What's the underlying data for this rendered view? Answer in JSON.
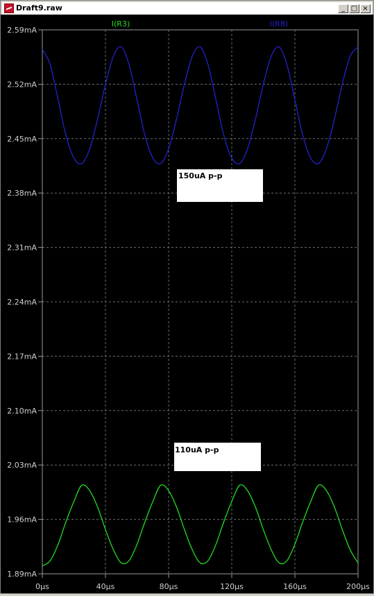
{
  "window": {
    "title": "Draft9.raw",
    "controls": {
      "minimize": "_",
      "restore": "□",
      "close": "×"
    }
  },
  "chart_data": {
    "type": "line",
    "xlim": [
      0,
      200
    ],
    "ylim": [
      1.89,
      2.59
    ],
    "grid": true,
    "x_tick_labels": [
      "0µs",
      "40µs",
      "80µs",
      "120µs",
      "160µs",
      "200µs"
    ],
    "y_tick_labels": [
      "2.59mA",
      "2.52mA",
      "2.45mA",
      "2.38mA",
      "2.31mA",
      "2.24mA",
      "2.17mA",
      "2.10mA",
      "2.03mA",
      "1.96mA",
      "1.89mA"
    ],
    "series": [
      {
        "name": "I(R3)",
        "color": "#22dd22",
        "legend_position": "top-center-left",
        "x": [
          0,
          5,
          10,
          15,
          20,
          25,
          30,
          35,
          40,
          45,
          50,
          55,
          60,
          65,
          70,
          75,
          80,
          85,
          90,
          95,
          100,
          105,
          110,
          115,
          120,
          125,
          130,
          135,
          140,
          145,
          150,
          155,
          160,
          165,
          170,
          175,
          180,
          185,
          190,
          195,
          200
        ],
        "y": [
          1.9,
          1.907,
          1.928,
          1.957,
          1.983,
          2.004,
          1.997,
          1.976,
          1.947,
          1.921,
          1.904,
          1.907,
          1.928,
          1.957,
          1.983,
          2.004,
          1.997,
          1.976,
          1.947,
          1.921,
          1.904,
          1.907,
          1.928,
          1.957,
          1.983,
          2.004,
          1.997,
          1.976,
          1.947,
          1.921,
          1.904,
          1.907,
          1.928,
          1.957,
          1.983,
          2.004,
          1.997,
          1.976,
          1.947,
          1.921,
          1.904
        ]
      },
      {
        "name": "I(R8)",
        "color": "#2222cc",
        "legend_position": "top-right",
        "x": [
          0,
          5,
          10,
          15,
          20,
          25,
          30,
          35,
          40,
          45,
          50,
          55,
          60,
          65,
          70,
          75,
          80,
          85,
          90,
          95,
          100,
          105,
          110,
          115,
          120,
          125,
          130,
          135,
          140,
          145,
          150,
          155,
          160,
          165,
          170,
          175,
          180,
          185,
          190,
          195,
          200
        ],
        "y": [
          2.565,
          2.545,
          2.5,
          2.454,
          2.425,
          2.418,
          2.437,
          2.475,
          2.52,
          2.556,
          2.568,
          2.545,
          2.5,
          2.454,
          2.425,
          2.418,
          2.437,
          2.475,
          2.52,
          2.556,
          2.568,
          2.545,
          2.5,
          2.454,
          2.425,
          2.418,
          2.437,
          2.475,
          2.52,
          2.556,
          2.568,
          2.545,
          2.5,
          2.454,
          2.425,
          2.418,
          2.437,
          2.475,
          2.52,
          2.556,
          2.568
        ]
      }
    ],
    "annotations": [
      {
        "text": "150uA p-p",
        "near_series": "I(R8)"
      },
      {
        "text": "110uA p-p",
        "near_series": "I(R3)"
      }
    ]
  }
}
